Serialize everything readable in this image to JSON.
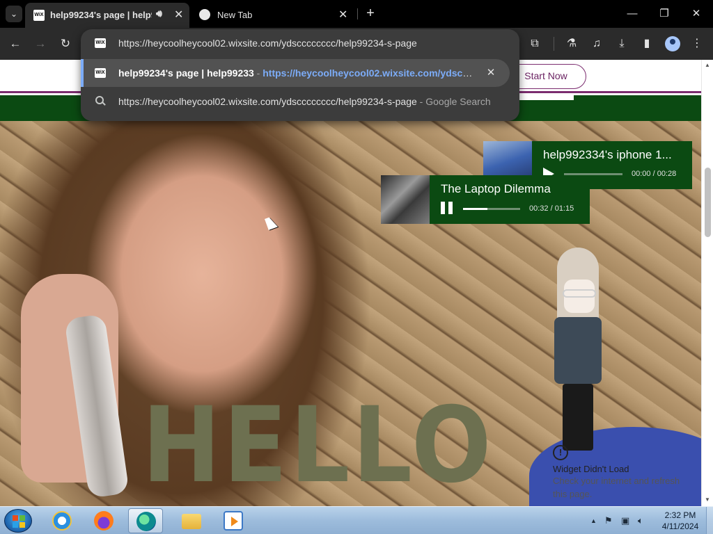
{
  "tabs": [
    {
      "title": "help99234's page | help99233",
      "favicon": "wix-icon",
      "audio": true,
      "active": true
    },
    {
      "title": "New Tab",
      "favicon": "globe-icon",
      "audio": false,
      "active": false
    }
  ],
  "omnibox": {
    "input_text": "https://heycoolheycool02.wixsite.com/ydscccccccc/help99234-s-page",
    "selected": {
      "title": "help99234's page | help99233",
      "dash": " - ",
      "url": "https://heycoolheycool02.wixsite.com/ydscccccccc/help99234-s-page"
    },
    "suggestion": {
      "text": "https://heycoolheycool02.wixsite.com/ydscccccccc/help99234-s-page",
      "dash": " - ",
      "hint": "Google Search"
    }
  },
  "site": {
    "start_button": "Start Now",
    "hero_text": "HELLO"
  },
  "players": [
    {
      "title": "help992334's iphone 1...",
      "time": "00:00 / 00:28",
      "state": "play",
      "progress": 0.0
    },
    {
      "title": "The Laptop Dilemma",
      "time": "00:32 / 01:15",
      "state": "pause",
      "progress": 0.43
    }
  ],
  "widget_error": {
    "title": "Widget Didn't Load",
    "message": "Check your internet and refresh this page."
  },
  "taskbar": {
    "time": "2:32 PM",
    "date": "4/11/2024"
  },
  "colors": {
    "site_green": "#0b4a12",
    "site_purple": "#7b2c6f",
    "link_blue": "#7cacf8",
    "hello_olive": "#6d7050"
  }
}
